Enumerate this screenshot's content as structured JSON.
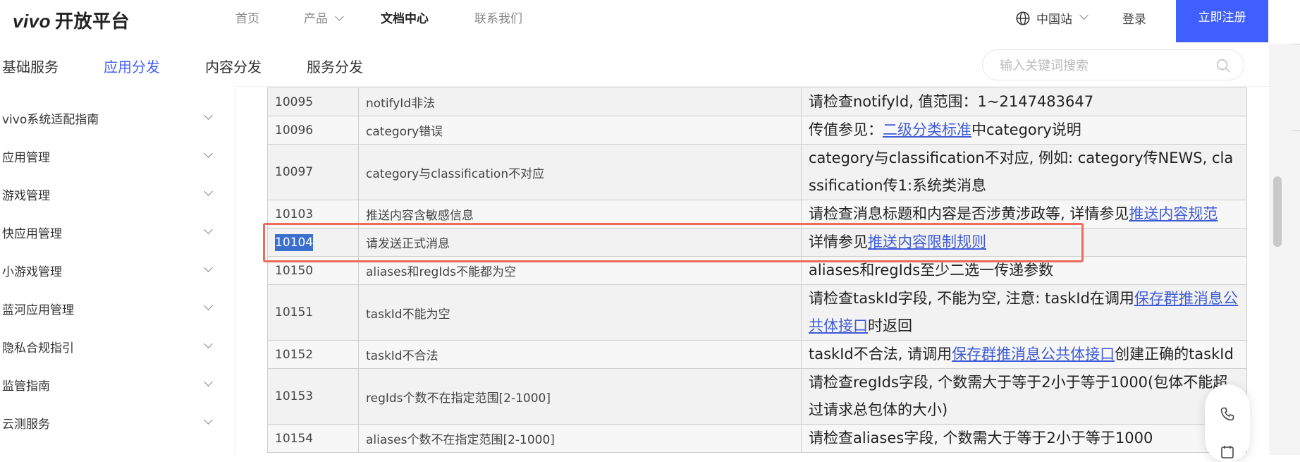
{
  "header": {
    "logo_brand": "vivo",
    "logo_text": "开放平台",
    "nav": [
      {
        "label": "首页"
      },
      {
        "label": "产品"
      },
      {
        "label": "文档中心"
      },
      {
        "label": "联系我们"
      }
    ],
    "region": "中国站",
    "login": "登录",
    "register": "立即注册"
  },
  "subnav": {
    "items": [
      {
        "label": "基础服务"
      },
      {
        "label": "应用分发"
      },
      {
        "label": "内容分发"
      },
      {
        "label": "服务分发"
      }
    ],
    "active_index": 1,
    "search_placeholder": "输入关键词搜索"
  },
  "sidebar": {
    "items": [
      {
        "label": "vivo系统适配指南"
      },
      {
        "label": "应用管理"
      },
      {
        "label": "游戏管理"
      },
      {
        "label": "快应用管理"
      },
      {
        "label": "小游戏管理"
      },
      {
        "label": "蓝河应用管理"
      },
      {
        "label": "隐私合规指引"
      },
      {
        "label": "监管指南"
      },
      {
        "label": "云测服务"
      }
    ]
  },
  "table": {
    "rows": [
      {
        "code": "10095",
        "desc": "notifyId非法",
        "sol_pre": "请检查notifyId, 值范围：1~2147483647",
        "sol_link": "",
        "sol_post": ""
      },
      {
        "code": "10096",
        "desc": "category错误",
        "sol_pre": "传值参见：",
        "sol_link": "二级分类标准",
        "sol_post": "中category说明"
      },
      {
        "code": "10097",
        "desc": "category与classification不对应",
        "sol_pre": "category与classification不对应, 例如: category传NEWS, classification传1:系统类消息",
        "sol_link": "",
        "sol_post": ""
      },
      {
        "code": "10103",
        "desc": "推送内容含敏感信息",
        "sol_pre": "请检查消息标题和内容是否涉黄涉政等, 详情参见",
        "sol_link": "推送内容规范",
        "sol_post": ""
      },
      {
        "code": "10104",
        "desc": "请发送正式消息",
        "sol_pre": "详情参见",
        "sol_link": "推送内容限制规则",
        "sol_post": ""
      },
      {
        "code": "10150",
        "desc": "aliases和regIds不能都为空",
        "sol_pre": "aliases和regIds至少二选一传递参数",
        "sol_link": "",
        "sol_post": ""
      },
      {
        "code": "10151",
        "desc": "taskId不能为空",
        "sol_pre": "请检查taskId字段, 不能为空, 注意: taskId在调用",
        "sol_link": "保存群推消息公共体接口",
        "sol_post": "时返回"
      },
      {
        "code": "10152",
        "desc": "taskId不合法",
        "sol_pre": "taskId不合法, 请调用",
        "sol_link": "保存群推消息公共体接口",
        "sol_post": "创建正确的taskId"
      },
      {
        "code": "10153",
        "desc": "regIds个数不在指定范围[2-1000]",
        "sol_pre": "请检查regIds字段, 个数需大于等于2小于等于1000(包体不能超过请求总包体的大小)",
        "sol_link": "",
        "sol_post": ""
      },
      {
        "code": "10154",
        "desc": "aliases个数不在指定范围[2-1000]",
        "sol_pre": "请检查aliases字段, 个数需大于等于2小于等于1000",
        "sol_link": "",
        "sol_post": ""
      }
    ]
  }
}
